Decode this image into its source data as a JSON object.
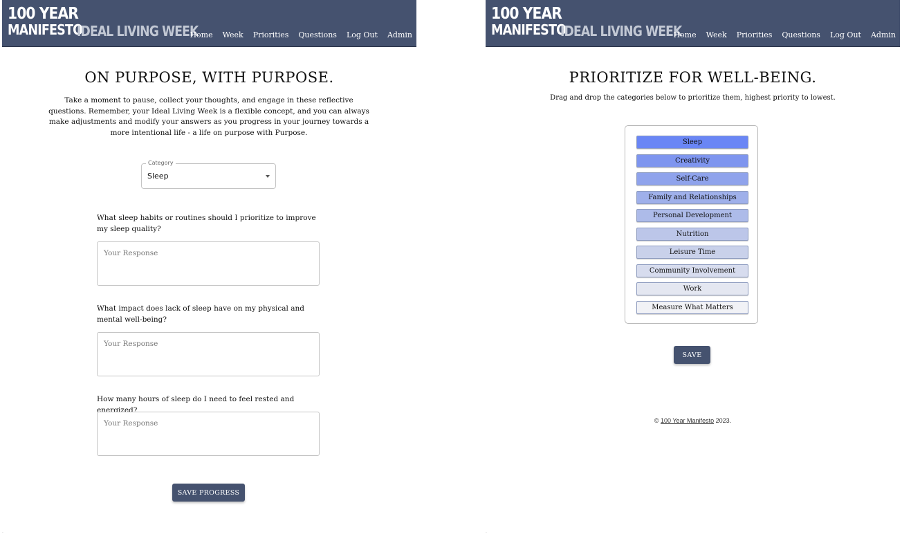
{
  "brand": {
    "line1": "100 YEAR",
    "line2": "MANIFESTO",
    "subtitle": "IDEAL LIVING WEEK"
  },
  "nav": {
    "items": [
      "Home",
      "Week",
      "Priorities",
      "Questions",
      "Log Out",
      "Admin"
    ]
  },
  "questions_page": {
    "heading": "ON PURPOSE, WITH PURPOSE.",
    "intro": "Take a moment to pause, collect your thoughts, and engage in these reflective questions. Remember, your Ideal Living Week is a flexible concept, and you can always make adjustments and modify your answers as you progress in your journey towards a more intentional life - a life on purpose with Purpose.",
    "category_label": "Category",
    "category_value": "Sleep",
    "questions": [
      {
        "text": "What sleep habits or routines should I prioritize to improve my sleep quality?",
        "placeholder": "Your Response"
      },
      {
        "text": "What impact does lack of sleep have on my physical and mental well-being?",
        "placeholder": "Your Response"
      },
      {
        "text": "How many hours of sleep do I need to feel rested and energized?",
        "placeholder": "Your Response"
      }
    ],
    "save_label": "SAVE PROGRESS"
  },
  "priorities_page": {
    "heading": "PRIORITIZE FOR WELL-BEING.",
    "subtitle": "Drag and drop the categories below to prioritize them, highest priority to lowest.",
    "categories": [
      {
        "label": "Sleep",
        "color": "#6a86f5"
      },
      {
        "label": "Creativity",
        "color": "#7e95ef"
      },
      {
        "label": "Self-Care",
        "color": "#8fa3ec"
      },
      {
        "label": "Family and Relationships",
        "color": "#9fb0ea"
      },
      {
        "label": "Personal Development",
        "color": "#adbbe9"
      },
      {
        "label": "Nutrition",
        "color": "#bcc6e9"
      },
      {
        "label": "Leisure Time",
        "color": "#c9d1ea"
      },
      {
        "label": "Community Involvement",
        "color": "#d7dcee"
      },
      {
        "label": "Work",
        "color": "#e4e7f1"
      },
      {
        "label": "Measure What Matters",
        "color": "#f1f2f6"
      }
    ],
    "save_label": "SAVE",
    "footer": {
      "copyright": "©",
      "link": "100 Year Manifesto",
      "year": "2023."
    }
  }
}
